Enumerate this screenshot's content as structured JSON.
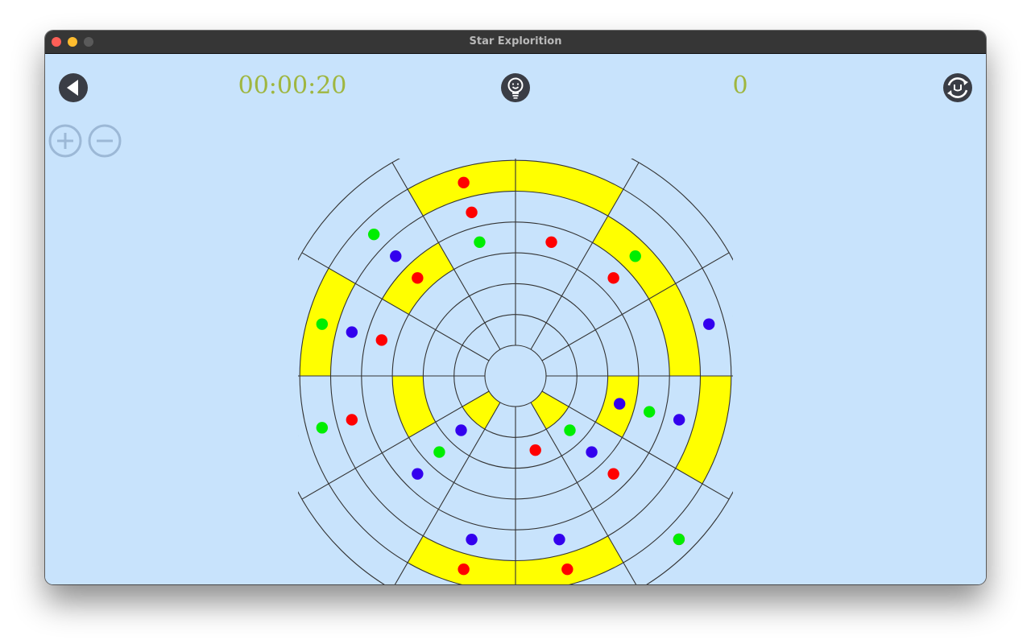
{
  "window": {
    "title": "Star Explorition"
  },
  "toolbar": {
    "timer": "00:00:20",
    "score": "0",
    "icons": {
      "back": "back-arrow-icon",
      "hint": "lightbulb-hint-icon",
      "restart": "restart-icon",
      "zoom_in": "zoom-in-icon",
      "zoom_out": "zoom-out-icon"
    }
  },
  "board": {
    "rings": 7,
    "sectors": 12,
    "sector_0_start": "north, clockwise",
    "colors": {
      "grid": "#333333",
      "cell": "#c8e3fc",
      "highlight": "#ffff00",
      "red": "#ff0000",
      "green": "#00ee00",
      "blue": "#3300ee"
    },
    "highlighted_cells": [
      {
        "ring": 1,
        "sector": 4
      },
      {
        "ring": 1,
        "sector": 7
      },
      {
        "ring": 3,
        "sector": 3
      },
      {
        "ring": 3,
        "sector": 8
      },
      {
        "ring": 4,
        "sector": 10
      },
      {
        "ring": 5,
        "sector": 1
      },
      {
        "ring": 5,
        "sector": 2
      },
      {
        "ring": 6,
        "sector": 0
      },
      {
        "ring": 6,
        "sector": 11
      },
      {
        "ring": 6,
        "sector": 5
      },
      {
        "ring": 6,
        "sector": 6
      },
      {
        "ring": 6,
        "sector": 3
      },
      {
        "ring": 6,
        "sector": 9
      }
    ],
    "marbles": [
      {
        "color": "blue",
        "ring": 7,
        "sector": 11
      },
      {
        "color": "green",
        "ring": 7,
        "sector": 0
      },
      {
        "color": "red",
        "ring": 6,
        "sector": 11
      },
      {
        "color": "red",
        "ring": 5,
        "sector": 11
      },
      {
        "color": "green",
        "ring": 6,
        "sector": 10
      },
      {
        "color": "blue",
        "ring": 5,
        "sector": 10
      },
      {
        "color": "green",
        "ring": 4,
        "sector": 11
      },
      {
        "color": "red",
        "ring": 4,
        "sector": 0
      },
      {
        "color": "red",
        "ring": 4,
        "sector": 10
      },
      {
        "color": "green",
        "ring": 5,
        "sector": 1
      },
      {
        "color": "red",
        "ring": 4,
        "sector": 1
      },
      {
        "color": "green",
        "ring": 7,
        "sector": 2
      },
      {
        "color": "blue",
        "ring": 6,
        "sector": 2
      },
      {
        "color": "green",
        "ring": 6,
        "sector": 9
      },
      {
        "color": "blue",
        "ring": 5,
        "sector": 9
      },
      {
        "color": "red",
        "ring": 4,
        "sector": 9
      },
      {
        "color": "blue",
        "ring": 7,
        "sector": 8
      },
      {
        "color": "green",
        "ring": 6,
        "sector": 8
      },
      {
        "color": "red",
        "ring": 5,
        "sector": 8
      },
      {
        "color": "blue",
        "ring": 2,
        "sector": 7
      },
      {
        "color": "green",
        "ring": 3,
        "sector": 7
      },
      {
        "color": "red",
        "ring": 2,
        "sector": 5
      },
      {
        "color": "green",
        "ring": 2,
        "sector": 4
      },
      {
        "color": "blue",
        "ring": 3,
        "sector": 3
      },
      {
        "color": "green",
        "ring": 4,
        "sector": 3
      },
      {
        "color": "blue",
        "ring": 5,
        "sector": 3
      },
      {
        "color": "blue",
        "ring": 3,
        "sector": 4
      },
      {
        "color": "red",
        "ring": 4,
        "sector": 4
      },
      {
        "color": "blue",
        "ring": 4,
        "sector": 7
      },
      {
        "color": "green",
        "ring": 7,
        "sector": 8
      },
      {
        "color": "red",
        "ring": 7,
        "sector": 4
      },
      {
        "color": "green",
        "ring": 7,
        "sector": 4
      },
      {
        "color": "blue",
        "ring": 5,
        "sector": 5
      },
      {
        "color": "blue",
        "ring": 5,
        "sector": 6
      },
      {
        "color": "red",
        "ring": 6,
        "sector": 6
      },
      {
        "color": "red",
        "ring": 6,
        "sector": 5
      }
    ]
  }
}
